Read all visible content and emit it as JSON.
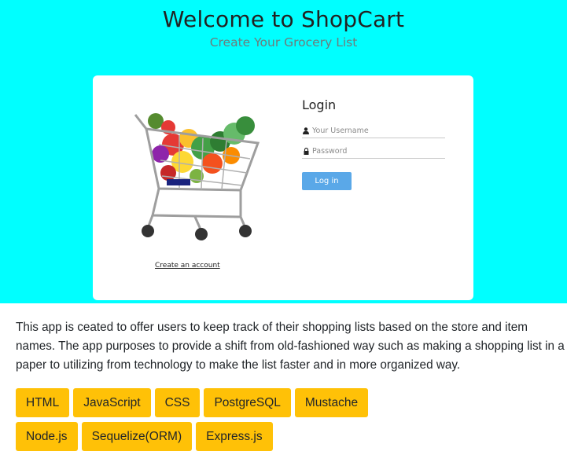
{
  "hero": {
    "title": "Welcome to ShopCart",
    "subtitle": "Create Your Grocery List",
    "background": "#00ffff"
  },
  "login": {
    "heading": "Login",
    "username_placeholder": "Your Username",
    "password_placeholder": "Password",
    "button_label": "Log in",
    "button_color": "#5aa8e8",
    "create_account_label": "Create an account",
    "image_icon": "shopping-cart-with-produce"
  },
  "description": "This app is ceated to offer users to keep track of their shopping lists based on the store and item names. The app purposes to provide a shift from old-fashioned way such as making a shopping list in a paper to utilizing from technology to make the list faster and in more organized way.",
  "tech_tags": {
    "color": "#ffc107",
    "rows": [
      [
        "HTML",
        "JavaScript",
        "CSS",
        "PostgreSQL",
        "Mustache"
      ],
      [
        "Node.js",
        "Sequelize(ORM)",
        "Express.js"
      ]
    ]
  }
}
